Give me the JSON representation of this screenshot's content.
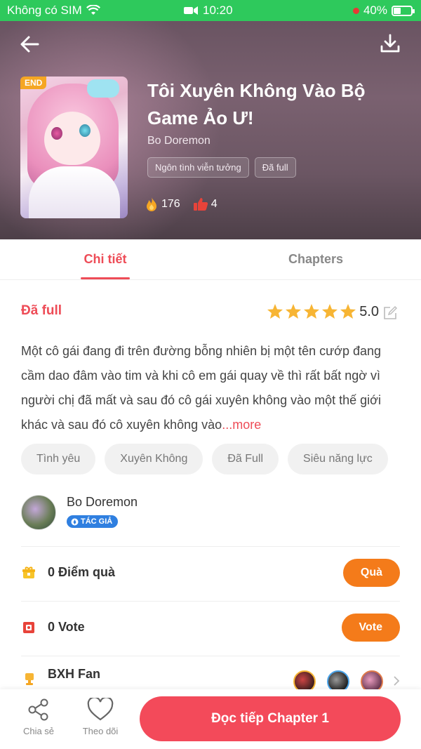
{
  "status_bar": {
    "carrier": "Không có SIM",
    "time": "10:20",
    "battery": "40%",
    "battery_level": 0.4
  },
  "book": {
    "badge": "END",
    "title": "Tôi Xuyên Không Vào Bộ Game Ảo Ư!",
    "author": "Bo Doremon",
    "tags": [
      "Ngôn tình viễn tưởng",
      "Đã full"
    ],
    "views": "176",
    "likes": "4"
  },
  "tabs": [
    {
      "label": "Chi tiết",
      "active": true
    },
    {
      "label": "Chapters",
      "active": false
    }
  ],
  "detail": {
    "status": "Đã full",
    "rating": "5.0",
    "stars": 5,
    "description": "Một cô gái đang đi trên đường bỗng nhiên bị một tên cướp đang cầm dao đâm vào tim và khi cô em gái quay về thì rất bất ngờ vì người chị đã mất và sau đó cô gái xuyên không vào một thế giới khác và sau đó cô xuyên không vào",
    "more": "...more",
    "genres": [
      "Tình yêu",
      "Xuyên Không",
      "Đã Full",
      "Siêu năng lực"
    ]
  },
  "author_card": {
    "name": "Bo Doremon",
    "badge": "TÁC GIẢ"
  },
  "gift_row": {
    "label": "0 Điểm quà",
    "button": "Quà"
  },
  "vote_row": {
    "label": "0 Vote",
    "button": "Vote"
  },
  "fan_row": {
    "label": "BXH Fan"
  },
  "bottom_bar": {
    "share": "Chia sẻ",
    "follow": "Theo dõi",
    "read": "Đọc tiếp Chapter 1"
  },
  "colors": {
    "status_bar": "#2ec95c",
    "accent": "#ee4c57",
    "orange": "#f47b1a",
    "star": "#f7b534"
  }
}
